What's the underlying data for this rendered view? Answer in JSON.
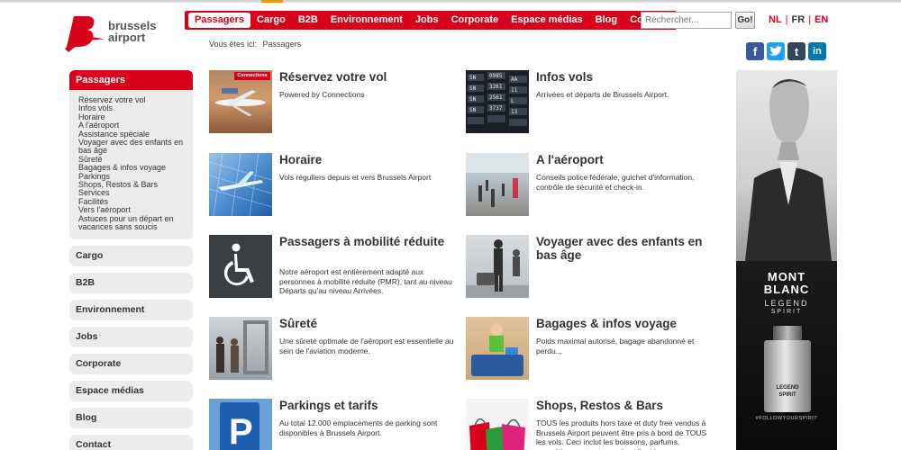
{
  "header": {
    "logo_line1": "brussels",
    "logo_line2": "airport",
    "nav": [
      "Passagers",
      "Cargo",
      "B2B",
      "Environnement",
      "Jobs",
      "Corporate",
      "Espace médias",
      "Blog",
      "Contact"
    ],
    "search_placeholder": "Rechercher...",
    "search_button": "Go!",
    "languages": [
      "NL",
      "FR",
      "EN"
    ]
  },
  "breadcrumb": {
    "prefix": "Vous êtes ici:",
    "current": "Passagers"
  },
  "sidebar": {
    "active_title": "Passagers",
    "sub_items": [
      "Réservez votre vol",
      "Infos vols",
      "Horaire",
      "A l'aéroport",
      "Assistance spéciale",
      "Voyager avec des enfants en bas âge",
      "Sûreté",
      "Bagages & infos voyage",
      "Parkings",
      "Shops, Restos & Bars",
      "Services",
      "Facilités",
      "Vers l'aéroport",
      "Astuces pour un départ en vacances sans soucis"
    ],
    "sections": [
      "Cargo",
      "B2B",
      "Environnement",
      "Jobs",
      "Corporate",
      "Espace médias",
      "Blog",
      "Contact"
    ]
  },
  "cards": [
    {
      "title": "Réservez votre vol",
      "desc": "Powered by Connections",
      "thumb_label": "Connections"
    },
    {
      "title": "Infos vols",
      "desc": "Arrivées et départs de Brussels Airport."
    },
    {
      "title": "Horaire",
      "desc": "Vols réguliers depuis et vers Brussels Airport"
    },
    {
      "title": "A l'aéroport",
      "desc": "Conseils police fédérale, guichet d'information, contrôle de sécurité et check-in."
    },
    {
      "title": "Passagers à mobilité réduite",
      "desc": "Notre aéroport est entièrement adapté aux personnes à mobilité réduite (PMR), tant au niveau Départs qu'au niveau Arrivées."
    },
    {
      "title": "Voyager avec des enfants en bas âge",
      "desc": ""
    },
    {
      "title": "Sûreté",
      "desc": "Une sûreté optimale de l'aéroport est essentielle au sein de l'aviation moderne."
    },
    {
      "title": "Bagages & infos voyage",
      "desc": "Poids maximal autorisé, bagage abandonné et perdu..."
    },
    {
      "title": "Parkings et tarifs",
      "desc": "Au total 12.000 emplacements de parking sont disponibles à Brussels Airport."
    },
    {
      "title": "Shops, Restos & Bars",
      "desc": "TOUS les produits hors taxe et duty free vendus à Brussels Airport peuvent être pris à bord de TOUS les vols. Ceci inclut les boissons, parfums, cosmétiques et autres gels et liquides."
    }
  ],
  "ad": {
    "brand_line1": "MONT",
    "brand_line2": "BLANC",
    "product_line1": "LEGEND",
    "product_line2": "SPIRIT",
    "bottle_line1": "LEGEND",
    "bottle_line2": "SPIRIT",
    "hashtag": "#FOLLOWYOURSPIRIT"
  },
  "colors": {
    "brand_red": "#d8001b",
    "card_title": "#333333",
    "social_fb": "#3b5998",
    "social_tw": "#1da1f2",
    "social_tumblr": "#35465c",
    "social_li": "#0077b5"
  }
}
